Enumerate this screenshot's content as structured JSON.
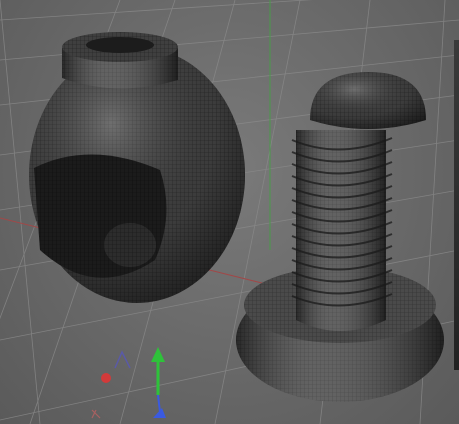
{
  "viewport": {
    "background_color": "#6b6b6b",
    "grid_color": "#8a8a8a",
    "world_axes": {
      "x_axis_color": "#a04848",
      "z_axis_color": "#4a9a4a"
    }
  },
  "objects": [
    {
      "name": "ring-nut",
      "mesh": "wireframe-shaded"
    },
    {
      "name": "threaded-screw",
      "mesh": "wireframe-shaded"
    }
  ],
  "axis_gizmo": {
    "x_color": "#d23a3a",
    "y_color": "#2ec23a",
    "z_color": "#3a5ae0"
  }
}
